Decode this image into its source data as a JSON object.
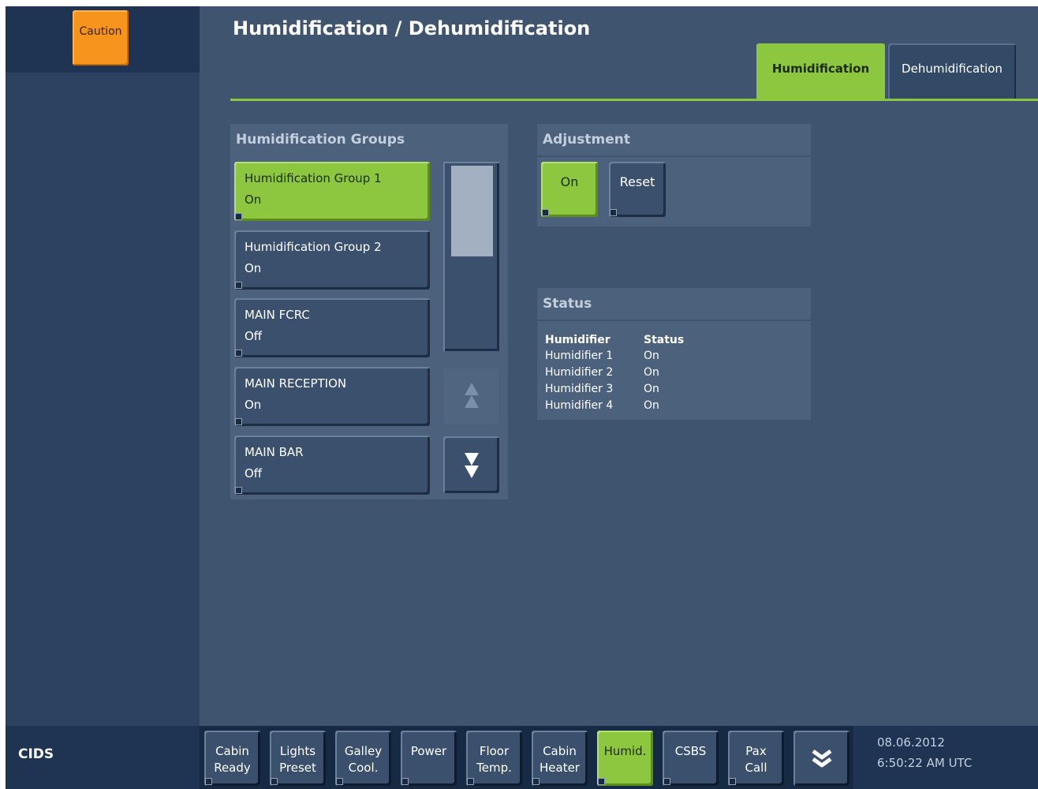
{
  "header": {
    "caution_label": "Caution",
    "title": "Humidification / Dehumidification"
  },
  "tabs": [
    {
      "label": "Humidification",
      "active": true
    },
    {
      "label": "Dehumidification",
      "active": false
    }
  ],
  "groups": {
    "header": "Humidification Groups",
    "items": [
      {
        "name": "Humidification Group 1",
        "state": "On",
        "selected": true
      },
      {
        "name": "Humidification Group 2",
        "state": "On",
        "selected": false
      },
      {
        "name": "MAIN FCRC",
        "state": "Off",
        "selected": false
      },
      {
        "name": "MAIN RECEPTION",
        "state": "On",
        "selected": false
      },
      {
        "name": "MAIN BAR",
        "state": "Off",
        "selected": false
      }
    ]
  },
  "adjustment": {
    "header": "Adjustment",
    "on_label": "On",
    "reset_label": "Reset"
  },
  "status": {
    "header": "Status",
    "col_humidifier": "Humidifier",
    "col_status": "Status",
    "rows": [
      {
        "name": "Humidifier 1",
        "status": "On"
      },
      {
        "name": "Humidifier 2",
        "status": "On"
      },
      {
        "name": "Humidifier 3",
        "status": "On"
      },
      {
        "name": "Humidifier 4",
        "status": "On"
      }
    ]
  },
  "bottom": {
    "app_name": "CIDS",
    "nav": [
      {
        "line1": "Cabin",
        "line2": "Ready"
      },
      {
        "line1": "Lights",
        "line2": "Preset"
      },
      {
        "line1": "Galley",
        "line2": "Cool."
      },
      {
        "line1": "Power",
        "line2": ""
      },
      {
        "line1": "Floor",
        "line2": "Temp."
      },
      {
        "line1": "Cabin",
        "line2": "Heater"
      },
      {
        "line1": "Humid.",
        "line2": ""
      },
      {
        "line1": "CSBS",
        "line2": ""
      },
      {
        "line1": "Pax",
        "line2": "Call"
      }
    ],
    "date": "08.06.2012",
    "time": "6:50:22 AM UTC"
  },
  "colors": {
    "accent_green": "#8dc63f",
    "caution_orange": "#f7941d",
    "background": "#3f556f"
  }
}
